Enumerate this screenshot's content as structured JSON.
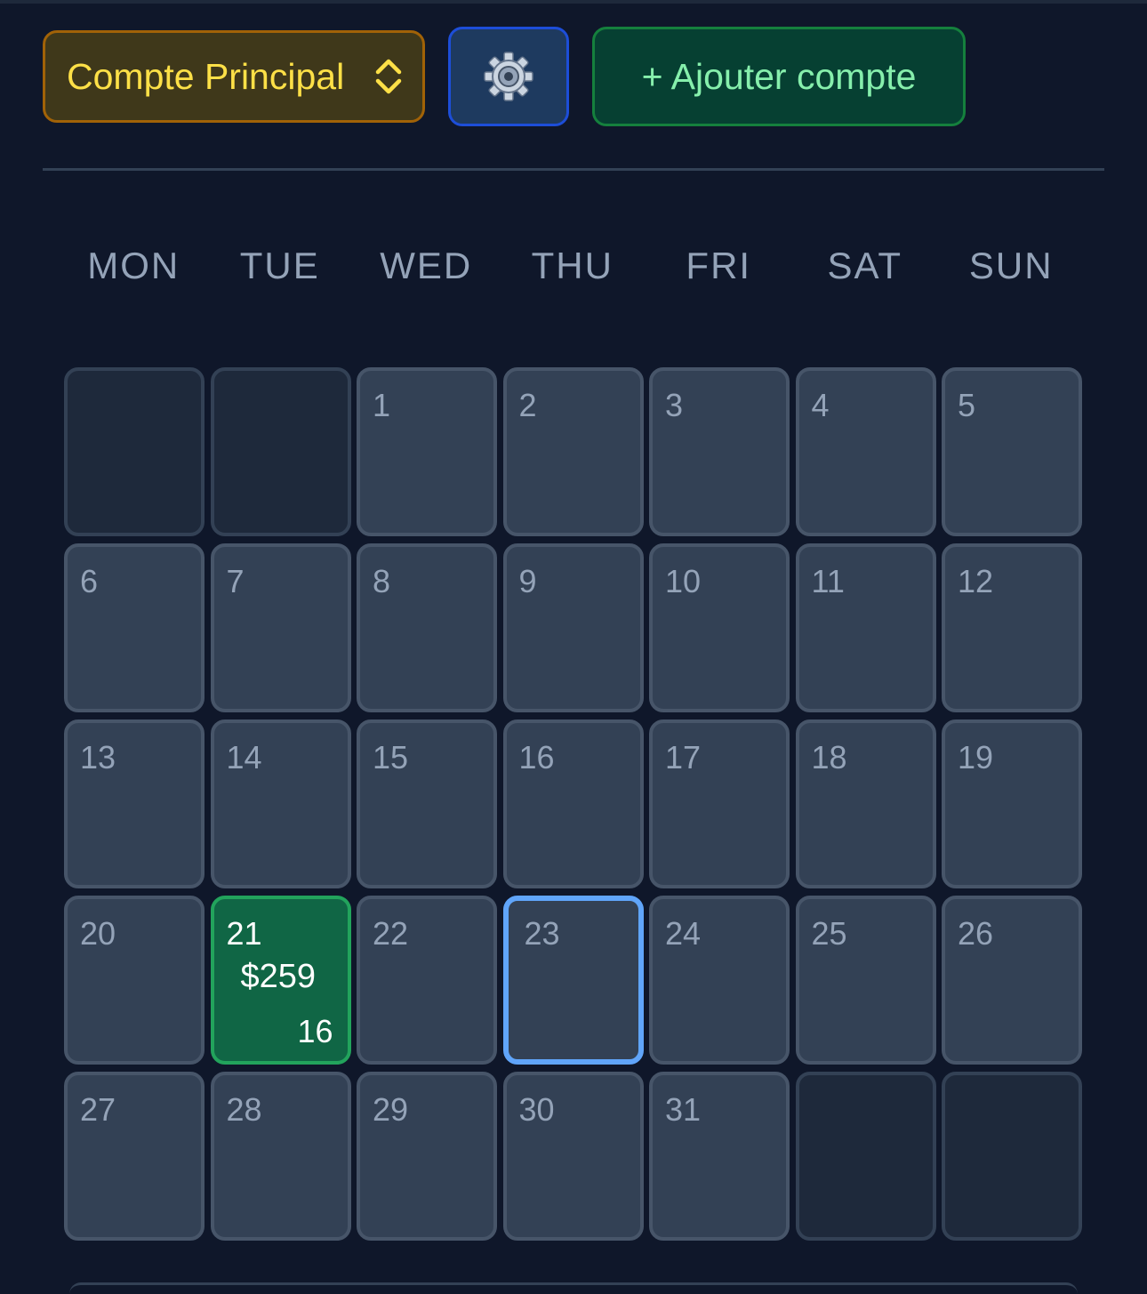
{
  "toolbar": {
    "account_label": "Compte Principal",
    "account_icon": "chevron-up-down-icon",
    "settings_icon": "gear-icon",
    "add_account_label": "+ Ajouter compte"
  },
  "colors": {
    "background": "#0f172a",
    "account_accent": "#fde047",
    "add_accent": "#86efac",
    "profit_day": "#106645",
    "today_outline": "#60a5fa"
  },
  "calendar": {
    "weekdays": [
      "MON",
      "TUE",
      "WED",
      "THU",
      "FRI",
      "SAT",
      "SUN"
    ],
    "today": "23",
    "weeks": [
      [
        {
          "day": ""
        },
        {
          "day": ""
        },
        {
          "day": "1"
        },
        {
          "day": "2"
        },
        {
          "day": "3"
        },
        {
          "day": "4"
        },
        {
          "day": "5"
        }
      ],
      [
        {
          "day": "6"
        },
        {
          "day": "7"
        },
        {
          "day": "8"
        },
        {
          "day": "9"
        },
        {
          "day": "10"
        },
        {
          "day": "11"
        },
        {
          "day": "12"
        }
      ],
      [
        {
          "day": "13"
        },
        {
          "day": "14"
        },
        {
          "day": "15"
        },
        {
          "day": "16"
        },
        {
          "day": "17"
        },
        {
          "day": "18"
        },
        {
          "day": "19"
        }
      ],
      [
        {
          "day": "20"
        },
        {
          "day": "21",
          "amount": "$259",
          "count": "16"
        },
        {
          "day": "22"
        },
        {
          "day": "23"
        },
        {
          "day": "24"
        },
        {
          "day": "25"
        },
        {
          "day": "26"
        }
      ],
      [
        {
          "day": "27"
        },
        {
          "day": "28"
        },
        {
          "day": "29"
        },
        {
          "day": "30"
        },
        {
          "day": "31"
        },
        {
          "day": ""
        },
        {
          "day": ""
        }
      ]
    ]
  }
}
